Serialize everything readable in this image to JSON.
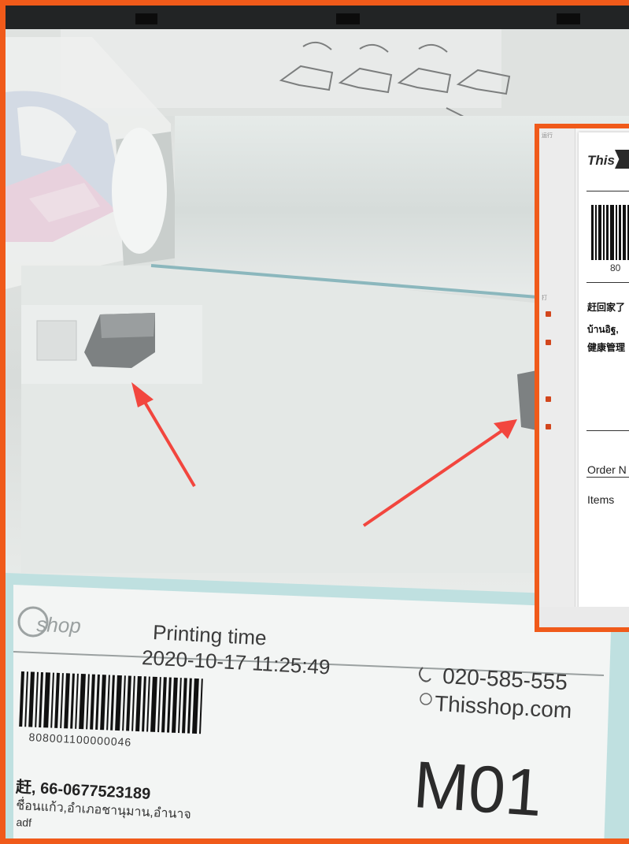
{
  "label": {
    "logo_text": "shop",
    "printing_time_label": "Printing time",
    "printing_time_value": "2020-10-17 11:25:49",
    "phone": "020-585-555",
    "website": "Thisshop.com",
    "barcode_number": "808001100000046",
    "route_code": "M01",
    "address_line_1": "赶, 66-0677523189",
    "address_line_2": "ชื่อนแก้ว,อำเภอชานุมาน,อำนาจ",
    "address_line_3": "adf"
  },
  "overlay": {
    "logo_text": "This",
    "barcode_number_partial": "80",
    "address_line_1": "赶回家了",
    "address_line_2": "บ้านอิฐ,",
    "address_line_3": "健康管理",
    "order_label": "Order N",
    "items_label": "Items",
    "side_caption_top": "运行",
    "side_caption_mid": "打"
  },
  "colors": {
    "highlight_border": "#f05a1a",
    "arrow": "#f2463e",
    "label_teal": "#bfe0e0"
  }
}
